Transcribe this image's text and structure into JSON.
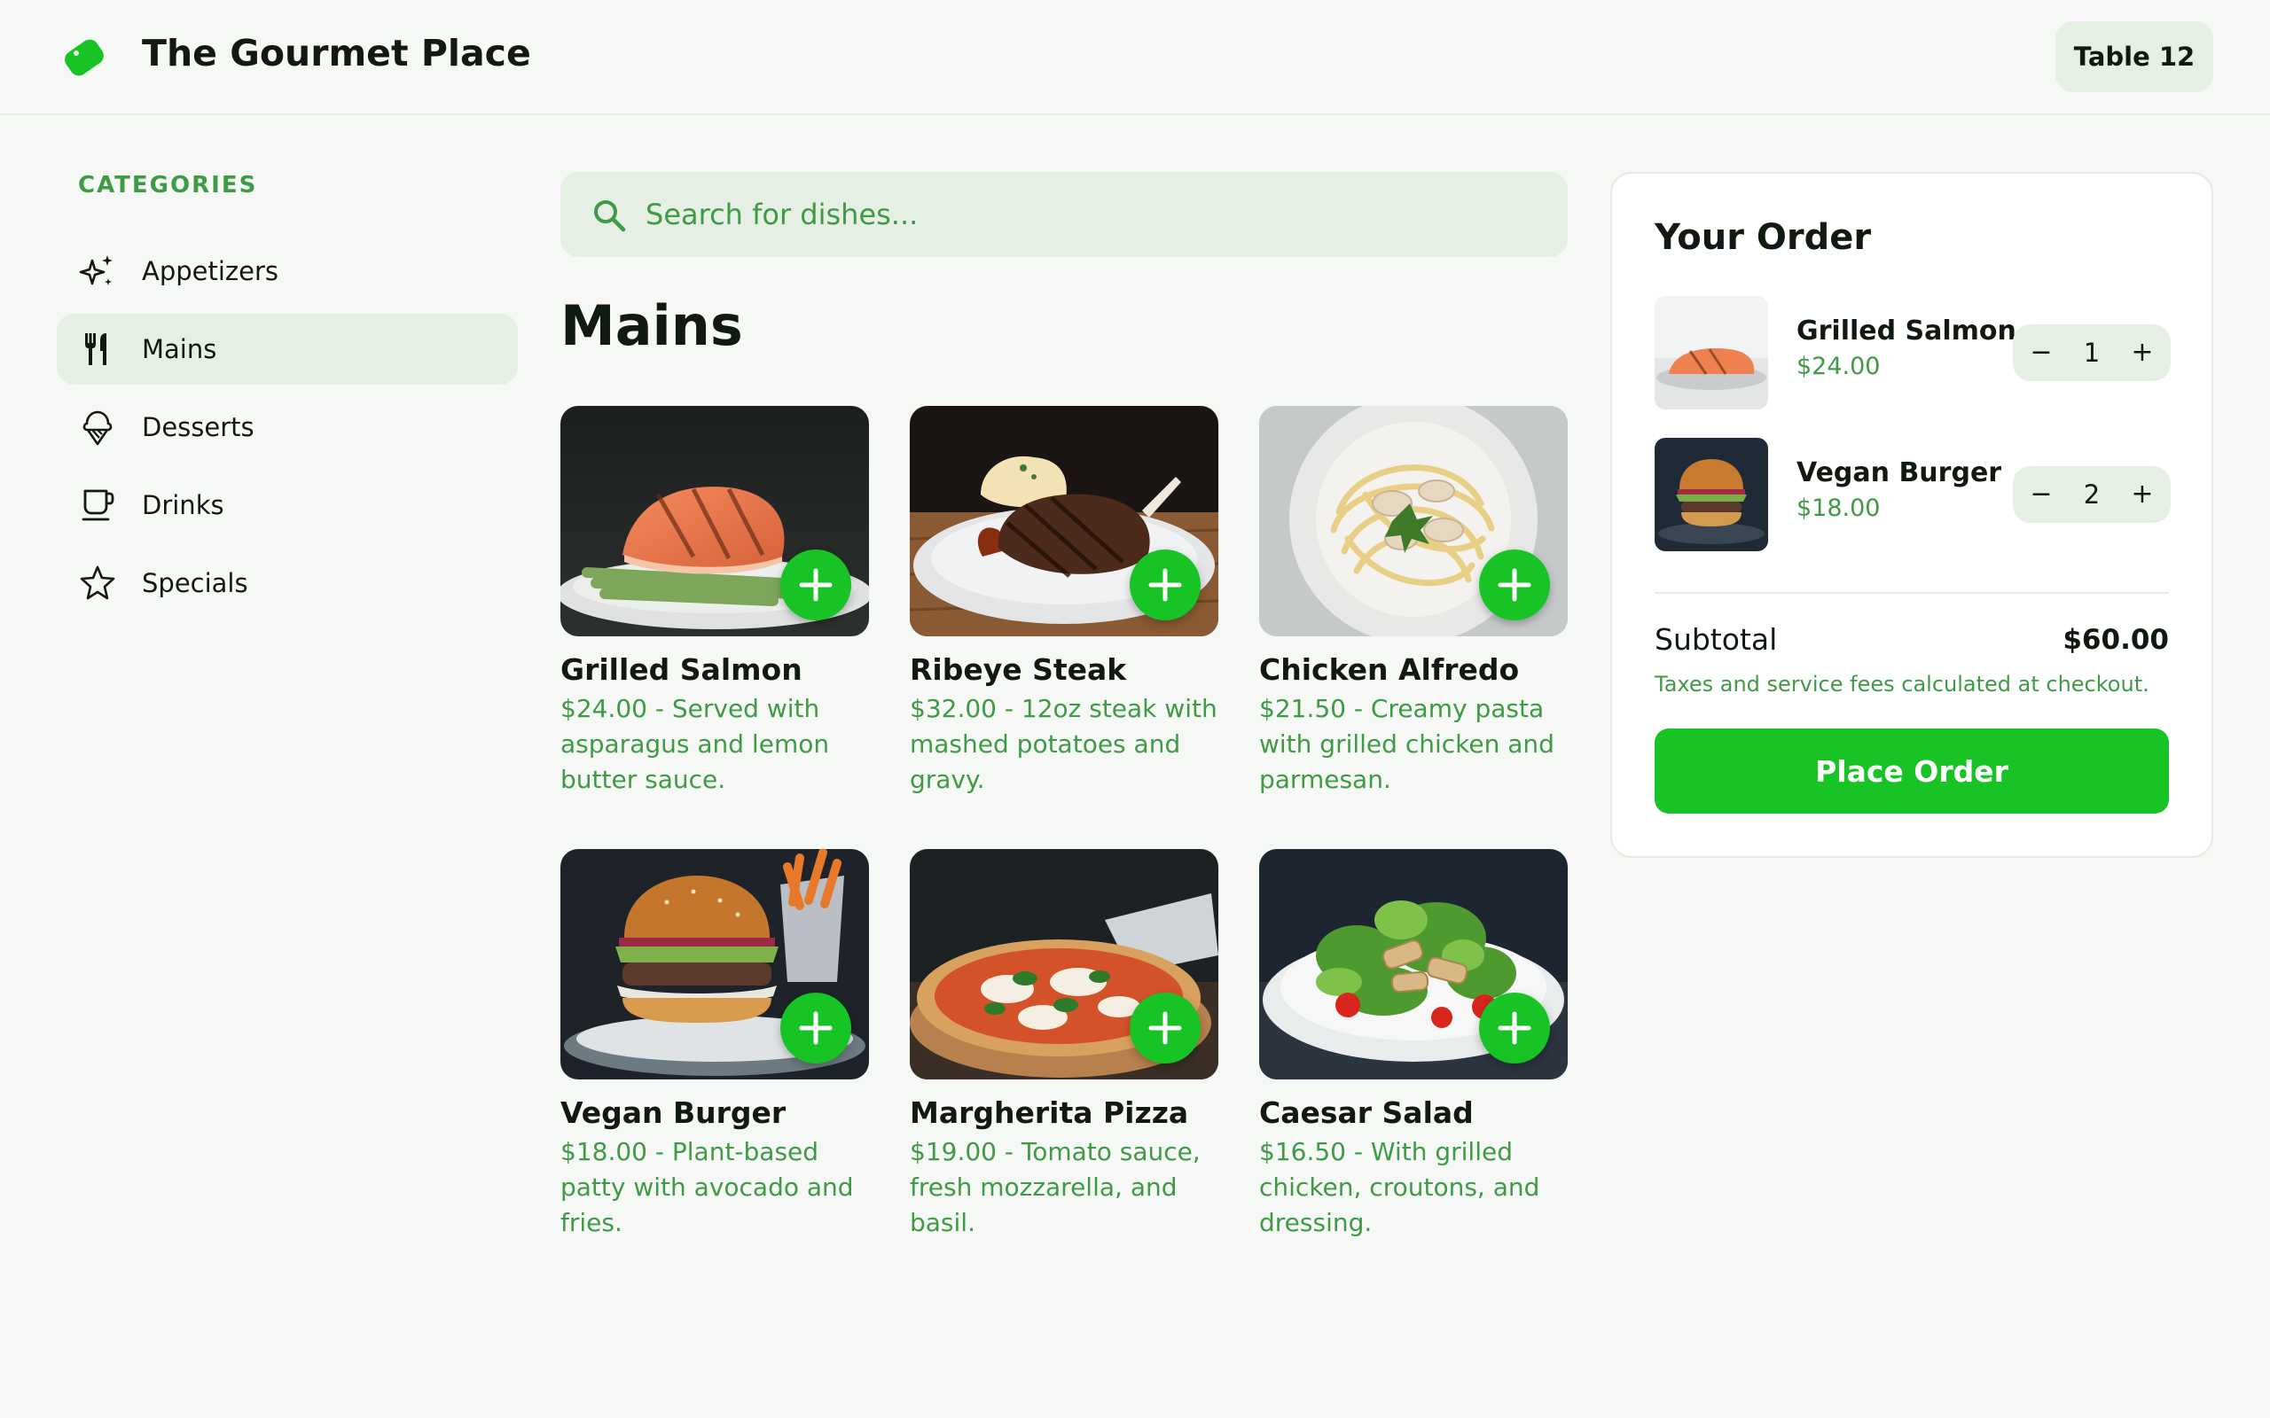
{
  "header": {
    "app_title": "The Gourmet Place",
    "table_label": "Table 12"
  },
  "sidebar": {
    "heading": "CATEGORIES",
    "items": [
      {
        "label": "Appetizers",
        "icon": "sparkles-icon",
        "active": false
      },
      {
        "label": "Mains",
        "icon": "utensils-icon",
        "active": true
      },
      {
        "label": "Desserts",
        "icon": "ice-cream-icon",
        "active": false
      },
      {
        "label": "Drinks",
        "icon": "coffee-cup-icon",
        "active": false
      },
      {
        "label": "Specials",
        "icon": "star-icon",
        "active": false
      }
    ]
  },
  "search": {
    "placeholder": "Search for dishes..."
  },
  "main": {
    "section_title": "Mains",
    "dishes": [
      {
        "name": "Grilled Salmon",
        "description": "$24.00 - Served with asparagus and lemon butter sauce."
      },
      {
        "name": "Ribeye Steak",
        "description": "$32.00 - 12oz steak with mashed potatoes and gravy."
      },
      {
        "name": "Chicken Alfredo",
        "description": "$21.50 - Creamy pasta with grilled chicken and parmesan."
      },
      {
        "name": "Vegan Burger",
        "description": "$18.00 - Plant-based patty with avocado and fries."
      },
      {
        "name": "Margherita Pizza",
        "description": "$19.00 - Tomato sauce, fresh mozzarella, and basil."
      },
      {
        "name": "Caesar Salad",
        "description": "$16.50 - With grilled chicken, croutons, and dressing."
      }
    ]
  },
  "order": {
    "title": "Your Order",
    "items": [
      {
        "name": "Grilled Salmon",
        "price": "$24.00",
        "quantity": "1"
      },
      {
        "name": "Vegan Burger",
        "price": "$18.00",
        "quantity": "2"
      }
    ],
    "qty_minus": "−",
    "qty_plus": "+",
    "subtotal_label": "Subtotal",
    "subtotal_value": "$60.00",
    "fee_note": "Taxes and service fees calculated at checkout.",
    "place_order_label": "Place Order"
  },
  "colors": {
    "accent": "#17c325",
    "accent_text": "#3f9a45",
    "soft_fill": "#e6efe3",
    "background": "#f6f8f5"
  }
}
